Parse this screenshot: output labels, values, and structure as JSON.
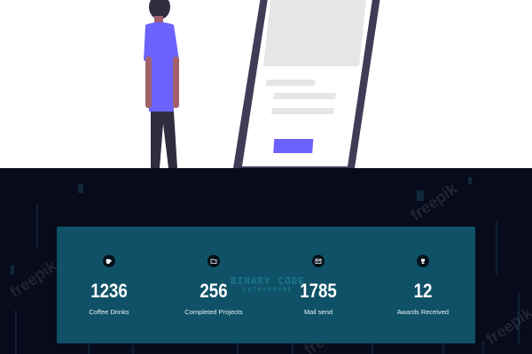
{
  "watermark": {
    "brand": "freepik"
  },
  "logo": {
    "title": "BINARY CODE",
    "subtitle": "BACKGROUND"
  },
  "stats": [
    {
      "icon": "coffee-cup-icon",
      "value": "1236",
      "label": "Coffee Drinks"
    },
    {
      "icon": "folder-icon",
      "value": "256",
      "label": "Completed Projects"
    },
    {
      "icon": "mail-icon",
      "value": "1785",
      "label": "Mail send"
    },
    {
      "icon": "trophy-icon",
      "value": "12",
      "label": "Awards Received"
    }
  ],
  "colors": {
    "accent": "#6c63ff",
    "band": "#070b1c",
    "panel": "#0f5166",
    "phone_frame": "#3f3d56"
  }
}
